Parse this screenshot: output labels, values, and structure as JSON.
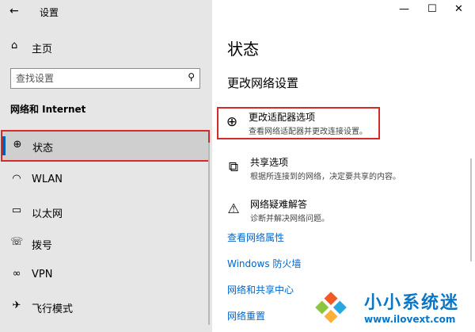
{
  "window": {
    "title": "设置"
  },
  "left_nav": {
    "home_label": "主页",
    "search_placeholder": "查找设置",
    "section_title": "网络和 Internet",
    "items": [
      {
        "label": "状态",
        "icon": "globe-icon",
        "active": true
      },
      {
        "label": "WLAN",
        "icon": "wifi-icon",
        "active": false
      },
      {
        "label": "以太网",
        "icon": "ethernet-icon",
        "active": false
      },
      {
        "label": "拨号",
        "icon": "phone-icon",
        "active": false
      },
      {
        "label": "VPN",
        "icon": "vpn-icon",
        "active": false
      },
      {
        "label": "飞行模式",
        "icon": "airplane-icon",
        "active": false
      }
    ]
  },
  "main": {
    "title": "状态",
    "subtitle": "更改网络设置",
    "options": [
      {
        "title": "更改适配器选项",
        "desc": "查看网络适配器并更改连接设置。",
        "icon": "adapter-icon"
      },
      {
        "title": "共享选项",
        "desc": "根据所连接到的网络，决定要共享的内容。",
        "icon": "sharing-icon"
      },
      {
        "title": "网络疑难解答",
        "desc": "诊断并解决网络问题。",
        "icon": "warning-icon"
      }
    ],
    "links": [
      "查看网络属性",
      "Windows 防火墙",
      "网络和共享中心",
      "网络重置"
    ]
  },
  "watermark": {
    "name": "小小系统迷",
    "url": "www.ilovext.com"
  },
  "colors": {
    "accent": "#0063b1",
    "link": "#0066cc",
    "highlight_border": "#d42a2a",
    "watermark": "#0a76c7"
  }
}
